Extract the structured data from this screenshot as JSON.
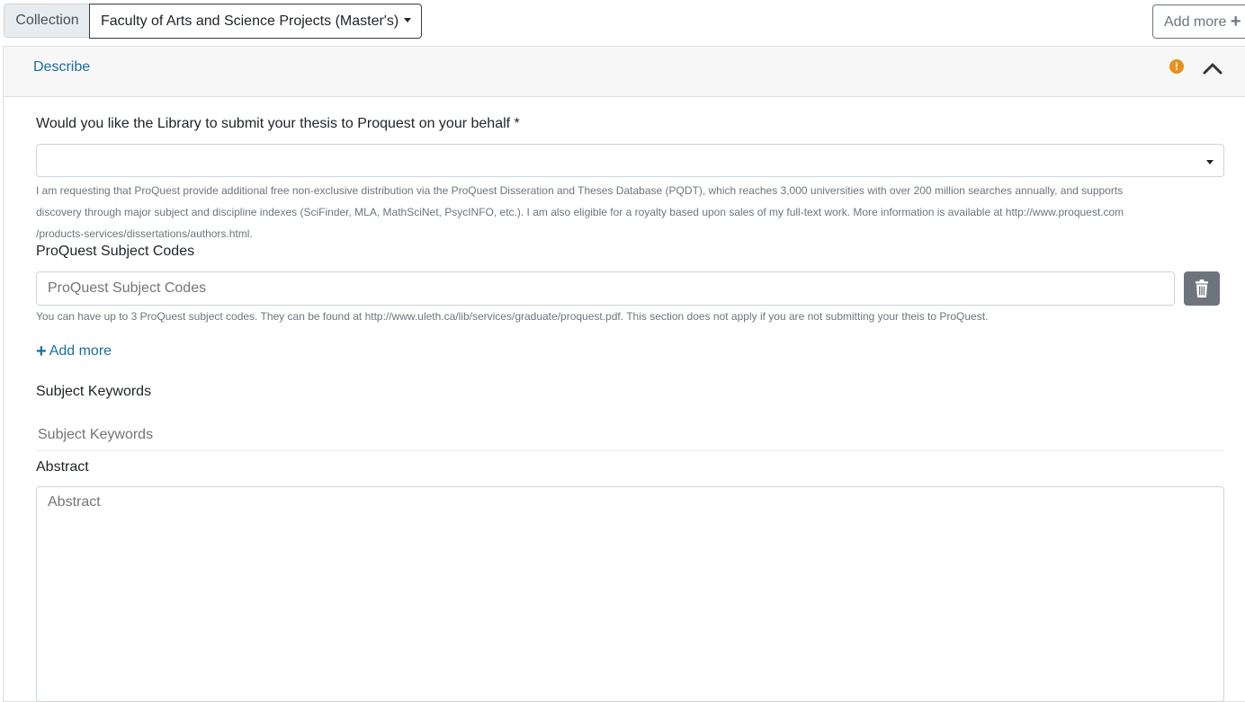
{
  "header": {
    "collection_label": "Collection",
    "collection_value": "Faculty of Arts and Science Projects (Master's)",
    "add_more_label": "Add more"
  },
  "section": {
    "title": "Describe",
    "warning_glyph": "!"
  },
  "form": {
    "proquest_question": {
      "label": "Would you like the Library to submit your thesis to Proquest on your behalf *",
      "value": "",
      "help_lines": [
        "I am requesting that ProQuest provide additional free non-exclusive distribution via the ProQuest Disseration and Theses Database (PQDT), which reaches 3,000 universities with over 200 million searches annually, and supports",
        "discovery through major subject and discipline indexes (SciFinder, MLA, MathSciNet, PsycINFO, etc.). I am also eligible for a royalty based upon sales of my full-text work. More information is available at http://www.proquest.com",
        "/products-services/dissertations/authors.html."
      ]
    },
    "subject_codes": {
      "label": "ProQuest Subject Codes",
      "placeholder": "ProQuest Subject Codes",
      "help": "You can have up to 3 ProQuest subject codes. They can be found at http://www.uleth.ca/lib/services/graduate/proquest.pdf. This section does not apply if you are not submitting your theis to ProQuest.",
      "add_more_label": "Add more"
    },
    "keywords": {
      "label": "Subject Keywords",
      "placeholder": "Subject Keywords"
    },
    "abstract": {
      "label": "Abstract",
      "placeholder": "Abstract"
    }
  },
  "icons": {
    "plus": "plus-icon",
    "trash": "trash-icon",
    "warning": "exclamation-circle-icon",
    "chevron": "chevron-up-icon"
  },
  "colors": {
    "link": "#1a6e9e",
    "warning": "#e8901a",
    "button_gray": "#6c757d"
  }
}
